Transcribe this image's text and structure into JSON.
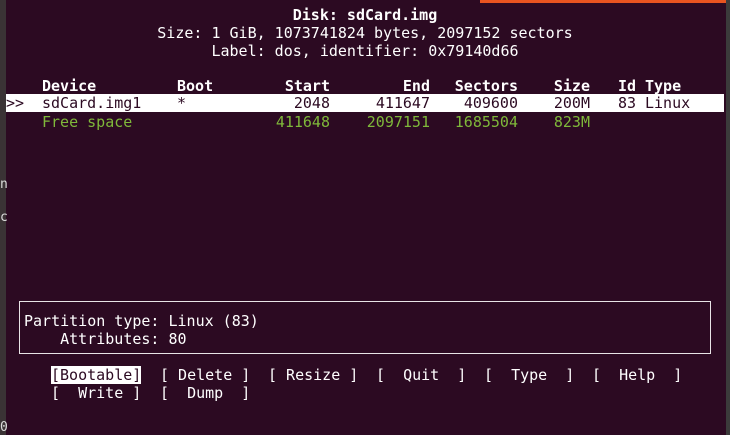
{
  "header": {
    "title": "Disk: sdCard.img",
    "size_line": "Size: 1 GiB, 1073741824 bytes, 2097152 sectors",
    "label_line": "Label: dos, identifier: 0x79140d66"
  },
  "table": {
    "columns": [
      "Device",
      "Boot",
      "Start",
      "End",
      "Sectors",
      "Size",
      "Id",
      "Type"
    ],
    "cursor": ">>",
    "rows": [
      {
        "device": "sdCard.img1",
        "boot": "*",
        "start": "2048",
        "end": "411647",
        "sectors": "409600",
        "size": "200M",
        "id": "83",
        "type": "Linux"
      },
      {
        "device": "Free space",
        "boot": "",
        "start": "411648",
        "end": "2097151",
        "sectors": "1685504",
        "size": "823M",
        "id": "",
        "type": ""
      }
    ]
  },
  "info": {
    "partition_type": "Partition type: Linux (83)",
    "attributes": "    Attributes: 80"
  },
  "menu": {
    "bootable": "[Bootable]",
    "delete": "[ Delete ]",
    "resize": "[ Resize ]",
    "quit": "[  Quit  ]",
    "type": "[  Type  ]",
    "help": "[  Help  ]",
    "write": "[  Write ]",
    "dump": "[  Dump  ]"
  },
  "colors": {
    "background": "#2c0a22",
    "free_space": "#7fb83a",
    "accent": "#e95420"
  }
}
